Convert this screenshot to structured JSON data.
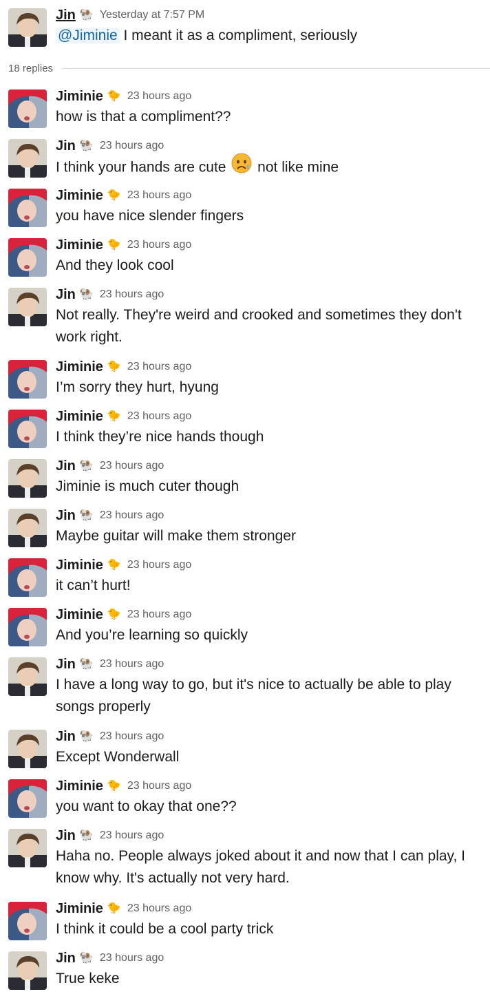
{
  "parent": {
    "user": "Jin",
    "emoji": "🐏",
    "time": "Yesterday at 7:57 PM",
    "mention": "@Jiminie",
    "text": " I meant it as a compliment, seriously"
  },
  "replies_label": "18 replies",
  "users": {
    "jin": {
      "name": "Jin",
      "emoji": "🐏"
    },
    "jiminie": {
      "name": "Jiminie",
      "emoji": "🐤"
    }
  },
  "replies": [
    {
      "user": "Jiminie",
      "emoji": "🐤",
      "time": "23 hours ago",
      "text": "how is that a compliment??"
    },
    {
      "user": "Jin",
      "emoji": "🐏",
      "time": "23 hours ago",
      "text": "I think your hands are cute",
      "emoji_inline": "disappointed-relieved-face",
      "text_after": " not like mine"
    },
    {
      "user": "Jiminie",
      "emoji": "🐤",
      "time": "23 hours ago",
      "text": "you have nice slender fingers"
    },
    {
      "user": "Jiminie",
      "emoji": "🐤",
      "time": "23 hours ago",
      "text": "And they look cool"
    },
    {
      "user": "Jin",
      "emoji": "🐏",
      "time": "23 hours ago",
      "text": "Not really. They're weird and crooked and sometimes they don't work right."
    },
    {
      "user": "Jiminie",
      "emoji": "🐤",
      "time": "23 hours ago",
      "text": "I’m sorry they hurt, hyung"
    },
    {
      "user": "Jiminie",
      "emoji": "🐤",
      "time": "23 hours ago",
      "text": "I think they’re nice hands though"
    },
    {
      "user": "Jin",
      "emoji": "🐏",
      "time": "23 hours ago",
      "text": "Jiminie is much cuter though"
    },
    {
      "user": "Jin",
      "emoji": "🐏",
      "time": "23 hours ago",
      "text": "Maybe guitar will make them stronger"
    },
    {
      "user": "Jiminie",
      "emoji": "🐤",
      "time": "23 hours ago",
      "text": "it can’t hurt!"
    },
    {
      "user": "Jiminie",
      "emoji": "🐤",
      "time": "23 hours ago",
      "text": "And you’re learning so quickly"
    },
    {
      "user": "Jin",
      "emoji": "🐏",
      "time": "23 hours ago",
      "text": "I have a long way to go, but it's nice to actually be able to play songs properly"
    },
    {
      "user": "Jin",
      "emoji": "🐏",
      "time": "23 hours ago",
      "text": "Except Wonderwall"
    },
    {
      "user": "Jiminie",
      "emoji": "🐤",
      "time": "23 hours ago",
      "text": "you want to okay that one??"
    },
    {
      "user": "Jin",
      "emoji": "🐏",
      "time": "23 hours ago",
      "text": "Haha no. People always joked about it and now that I can play, I know why. It's actually not very hard."
    },
    {
      "user": "Jiminie",
      "emoji": "🐤",
      "time": "23 hours ago",
      "text": "I think it could be a cool party trick"
    },
    {
      "user": "Jin",
      "emoji": "🐏",
      "time": "23 hours ago",
      "text": "True keke"
    }
  ]
}
